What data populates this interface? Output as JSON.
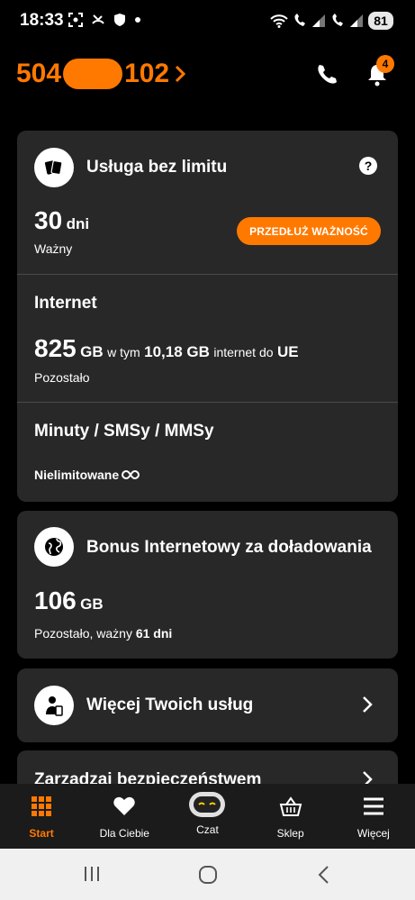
{
  "status_bar": {
    "time": "18:33",
    "battery": "81",
    "icons_left": [
      "screenshot-icon",
      "missed-call-icon",
      "shield-icon",
      "dot-icon"
    ],
    "icons_right": [
      "wifi-icon",
      "wifi-call-icon",
      "signal-icon",
      "wifi-call-2-icon",
      "signal-2-icon"
    ]
  },
  "header": {
    "number_prefix": "504",
    "number_suffix": "102",
    "notifications_count": "4"
  },
  "colors": {
    "accent": "#ff7900",
    "card": "#282828",
    "background": "#000000"
  },
  "service_card": {
    "title": "Usługa bez limitu",
    "days_value": "30",
    "days_unit": "dni",
    "validity_label": "Ważny",
    "extend_button": "PRZEDŁUŻ WAŻNOŚĆ",
    "internet_title": "Internet",
    "internet_value": "825",
    "internet_unit": "GB",
    "internet_in_text": "w tym",
    "internet_eu_value": "10,18 GB",
    "internet_eu_text": "internet do",
    "internet_eu_region": "UE",
    "internet_remaining_label": "Pozostało",
    "minutes_title": "Minuty / SMSy / MMSy",
    "minutes_value": "Nielimitowane"
  },
  "bonus_card": {
    "title": "Bonus Internetowy za doładowania",
    "value": "106",
    "unit": "GB",
    "remaining_label": "Pozostało, ważny",
    "valid_days": "61 dni"
  },
  "more_services_card": {
    "title": "Więcej Twoich usług"
  },
  "security_card": {
    "title": "Zarządzaj bezpieczeństwem"
  },
  "bottom_nav": {
    "items": [
      {
        "label": "Start",
        "icon": "grid-icon",
        "active": true
      },
      {
        "label": "Dla Ciebie",
        "icon": "heart-icon",
        "active": false
      },
      {
        "label": "Czat",
        "icon": "robot-icon",
        "active": false
      },
      {
        "label": "Sklep",
        "icon": "basket-icon",
        "active": false
      },
      {
        "label": "Więcej",
        "icon": "menu-icon",
        "active": false
      }
    ]
  }
}
